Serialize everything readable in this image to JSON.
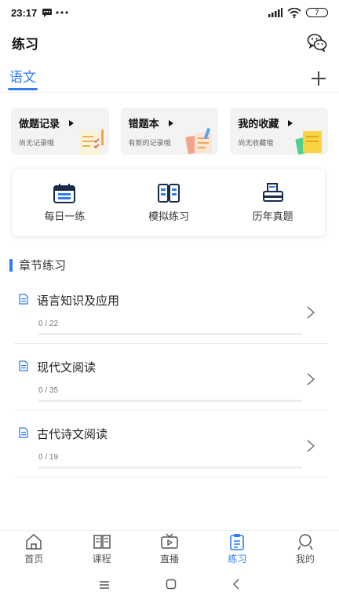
{
  "status_bar": {
    "time": "23:17",
    "battery": "7"
  },
  "header": {
    "title": "练习"
  },
  "subject": {
    "active_tab": "语文"
  },
  "record_cards": [
    {
      "title": "做题记录",
      "subtitle": "尚无记录哦"
    },
    {
      "title": "错题本",
      "subtitle": "有新的记录哦"
    },
    {
      "title": "我的收藏",
      "subtitle": "尚无收藏哦"
    }
  ],
  "quick_actions": [
    {
      "label": "每日一练",
      "icon": "calendar-icon"
    },
    {
      "label": "模拟练习",
      "icon": "book-icon"
    },
    {
      "label": "历年真题",
      "icon": "printer-icon"
    }
  ],
  "section": {
    "title": "章节练习"
  },
  "chapters": [
    {
      "title": "语言知识及应用",
      "count": "0 / 22",
      "progress": 0
    },
    {
      "title": "现代文阅读",
      "count": "0 / 35",
      "progress": 0
    },
    {
      "title": "古代诗文阅读",
      "count": "0 / 19",
      "progress": 0
    }
  ],
  "bottom_nav": [
    {
      "label": "首页",
      "icon": "home-icon"
    },
    {
      "label": "课程",
      "icon": "course-icon"
    },
    {
      "label": "直播",
      "icon": "live-tv-icon"
    },
    {
      "label": "练习",
      "icon": "clipboard-icon",
      "active": true
    },
    {
      "label": "我的",
      "icon": "profile-icon"
    }
  ],
  "colors": {
    "accent": "#2f7cf6",
    "card_bg": "#f3f3f3"
  }
}
